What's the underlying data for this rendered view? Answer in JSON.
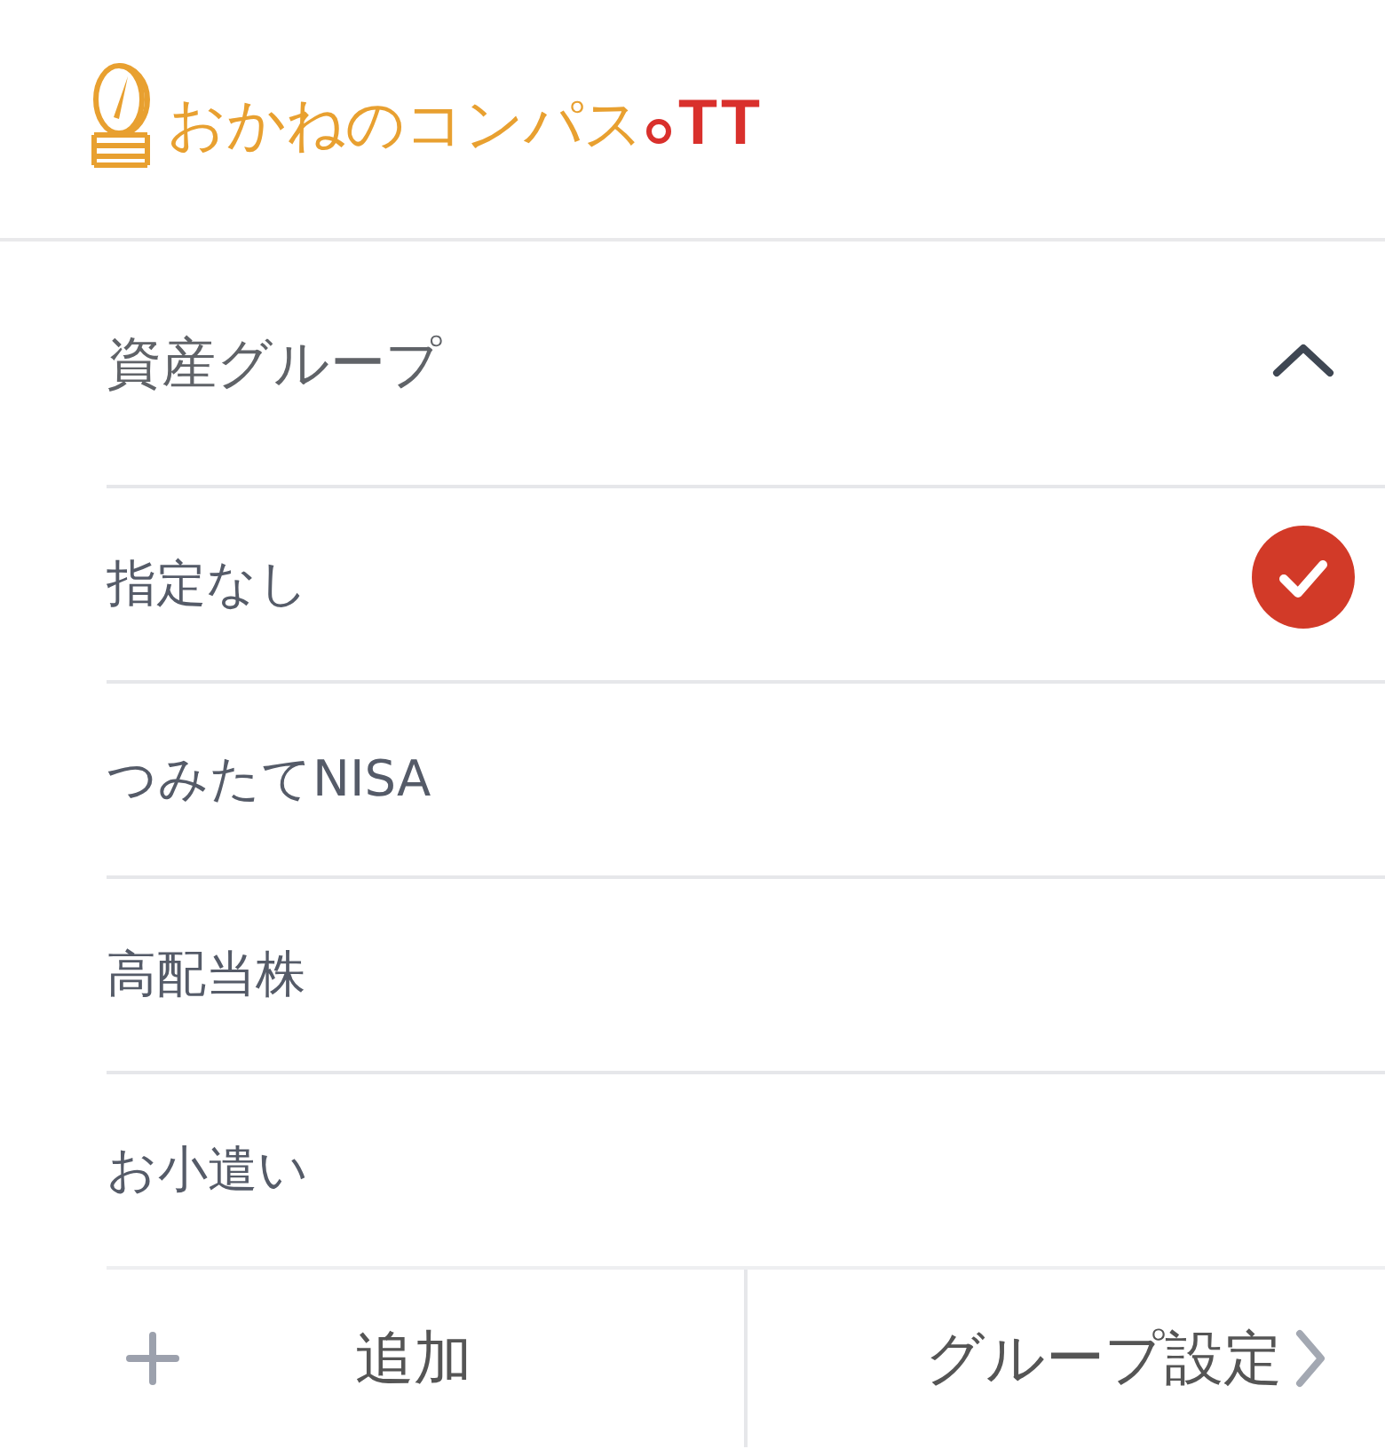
{
  "logo": {
    "name": "おかねのコンパス",
    "suffix": "TT"
  },
  "group_panel": {
    "title": "資産グループ",
    "expanded": true,
    "items": [
      {
        "label": "指定なし",
        "selected": true
      },
      {
        "label": "つみたてNISA",
        "selected": false
      },
      {
        "label": "高配当株",
        "selected": false
      },
      {
        "label": "お小遣い",
        "selected": false
      }
    ],
    "actions": {
      "add": "追加",
      "settings": "グループ設定"
    }
  }
}
